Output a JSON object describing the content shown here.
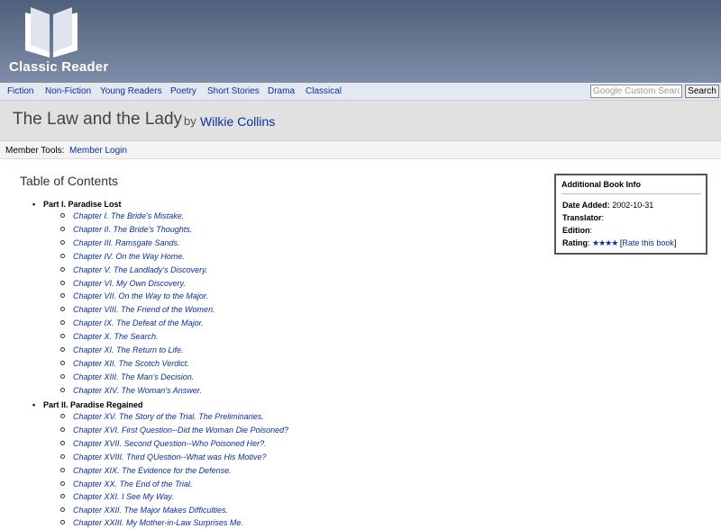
{
  "site": {
    "logo_text": "Classic Reader",
    "logo_icon": "open-book-icon"
  },
  "nav": {
    "items": [
      "Fiction",
      "Non-Fiction",
      "Young Readers",
      "Poetry",
      "Short Stories",
      "Drama",
      "Classical"
    ],
    "search_placeholder": "Google Custom Search",
    "search_button": "Search"
  },
  "book": {
    "title": "The Law and the Lady",
    "by": "by",
    "author": "Wilkie Collins"
  },
  "member": {
    "label": "Member Tools:",
    "login": "Member Login"
  },
  "toc": {
    "heading": "Table of Contents",
    "parts": [
      {
        "title": "Part I. Paradise Lost",
        "chapters": [
          "Chapter I. The Bride's Mistake.",
          "Chapter II. The Bride's Thoughts.",
          "Chapter III. Ramsgate Sands.",
          "Chapter IV. On the Way Home.",
          "Chapter V. The Landlady's Discovery.",
          "Chapter VI. My Own Discovery.",
          "Chapter VII. On the Way to the Major.",
          "Chapter VIII. The Friend of the Women.",
          "Chapter IX. The Defeat of the Major.",
          "Chapter X. The Search.",
          "Chapter XI. The Return to Life.",
          "Chapter XII. The Scotch Verdict.",
          "Chapter XIII. The Man's Decision.",
          "Chapter XIV. The Woman's Answer."
        ]
      },
      {
        "title": "Part II. Paradise Regained",
        "chapters": [
          "Chapter XV. The Story of the Trial. The Preliminaries.",
          "Chapter XVI. First Question--Did the Woman Die Poisoned?",
          "Chapter XVII. Second Question--Who Poisoned Her?.",
          "Chapter XVIII. Third QUestion--What was His Motive?",
          "Chapter XIX. The Evidence for the Defense.",
          "Chapter XX. The End of the Trial.",
          "Chapter XXI. I See My Way.",
          "Chapter XXII. The Major Makes Difficulties.",
          "Chapter XXIII. My Mother-in-Law Surprises Me."
        ]
      }
    ]
  },
  "info": {
    "title": "Additional Book Info",
    "date_label": "Date Added:",
    "date_value": "2002-10-31",
    "translator_label": "Translator",
    "translator_sep": ":",
    "edition_label": "Edition",
    "edition_sep": ":",
    "rating_label": "Rating",
    "rating_sep": ":",
    "rating_stars": "★★★★",
    "rate_open": "[",
    "rate_link": "Rate this book",
    "rate_close": "]"
  }
}
